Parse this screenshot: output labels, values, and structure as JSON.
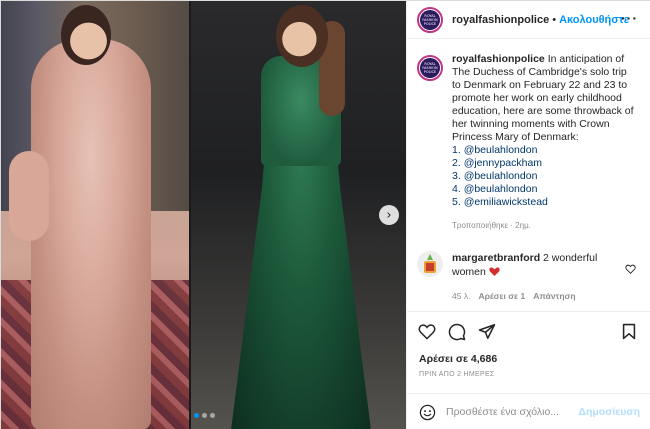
{
  "post": {
    "media": {
      "image_description": "Side-by-side photos: woman in pink sequin gown (left) and woman in green sequin gown (right)",
      "carousel_dots": 3,
      "active_dot": 0
    },
    "header": {
      "username": "royalfashionpolice",
      "separator": "•",
      "follow_label": "Ακολουθήστε",
      "more_label": "···",
      "avatar_text": "ROYAL FASHION POLICE"
    },
    "caption": {
      "username": "royalfashionpolice",
      "text": "In anticipation of The Duchess of Cambridge's solo trip to Denmark on February 22 and 23 to promote her work on early childhood education, here are some throwback of her twinning moments with Crown Princess Mary of Denmark:",
      "mentions": [
        {
          "num": "1. ",
          "handle": "@beulahlondon"
        },
        {
          "num": "2. ",
          "handle": "@jennypackham"
        },
        {
          "num": "3. ",
          "handle": "@beulahlondon"
        },
        {
          "num": "4. ",
          "handle": "@beulahlondon"
        },
        {
          "num": "5. ",
          "handle": "@emiliawickstead"
        }
      ],
      "edited": "Τροποποιήθηκε · 2ημ."
    },
    "comment": {
      "username": "margaretbranford",
      "text": "2 wonderful women",
      "age": "45 λ.",
      "likes": "Αρέσει σε 1",
      "reply": "Απάντηση"
    },
    "stats": {
      "likes": "Αρέσει σε 4,686",
      "time": "ΠΡΙΝ ΑΠΟ 2 ΗΜΕΡΕΣ"
    },
    "composer": {
      "placeholder": "Προσθέστε ένα σχόλιο...",
      "post_label": "Δημοσίευση"
    },
    "colors": {
      "link": "#00376b",
      "accent": "#0095f6",
      "post_disabled": "#b2dffc",
      "muted": "#8e8e8e"
    },
    "icons": [
      "heart-icon",
      "comment-icon",
      "share-icon",
      "bookmark-icon",
      "emoji-icon",
      "chevron-right-icon"
    ]
  }
}
